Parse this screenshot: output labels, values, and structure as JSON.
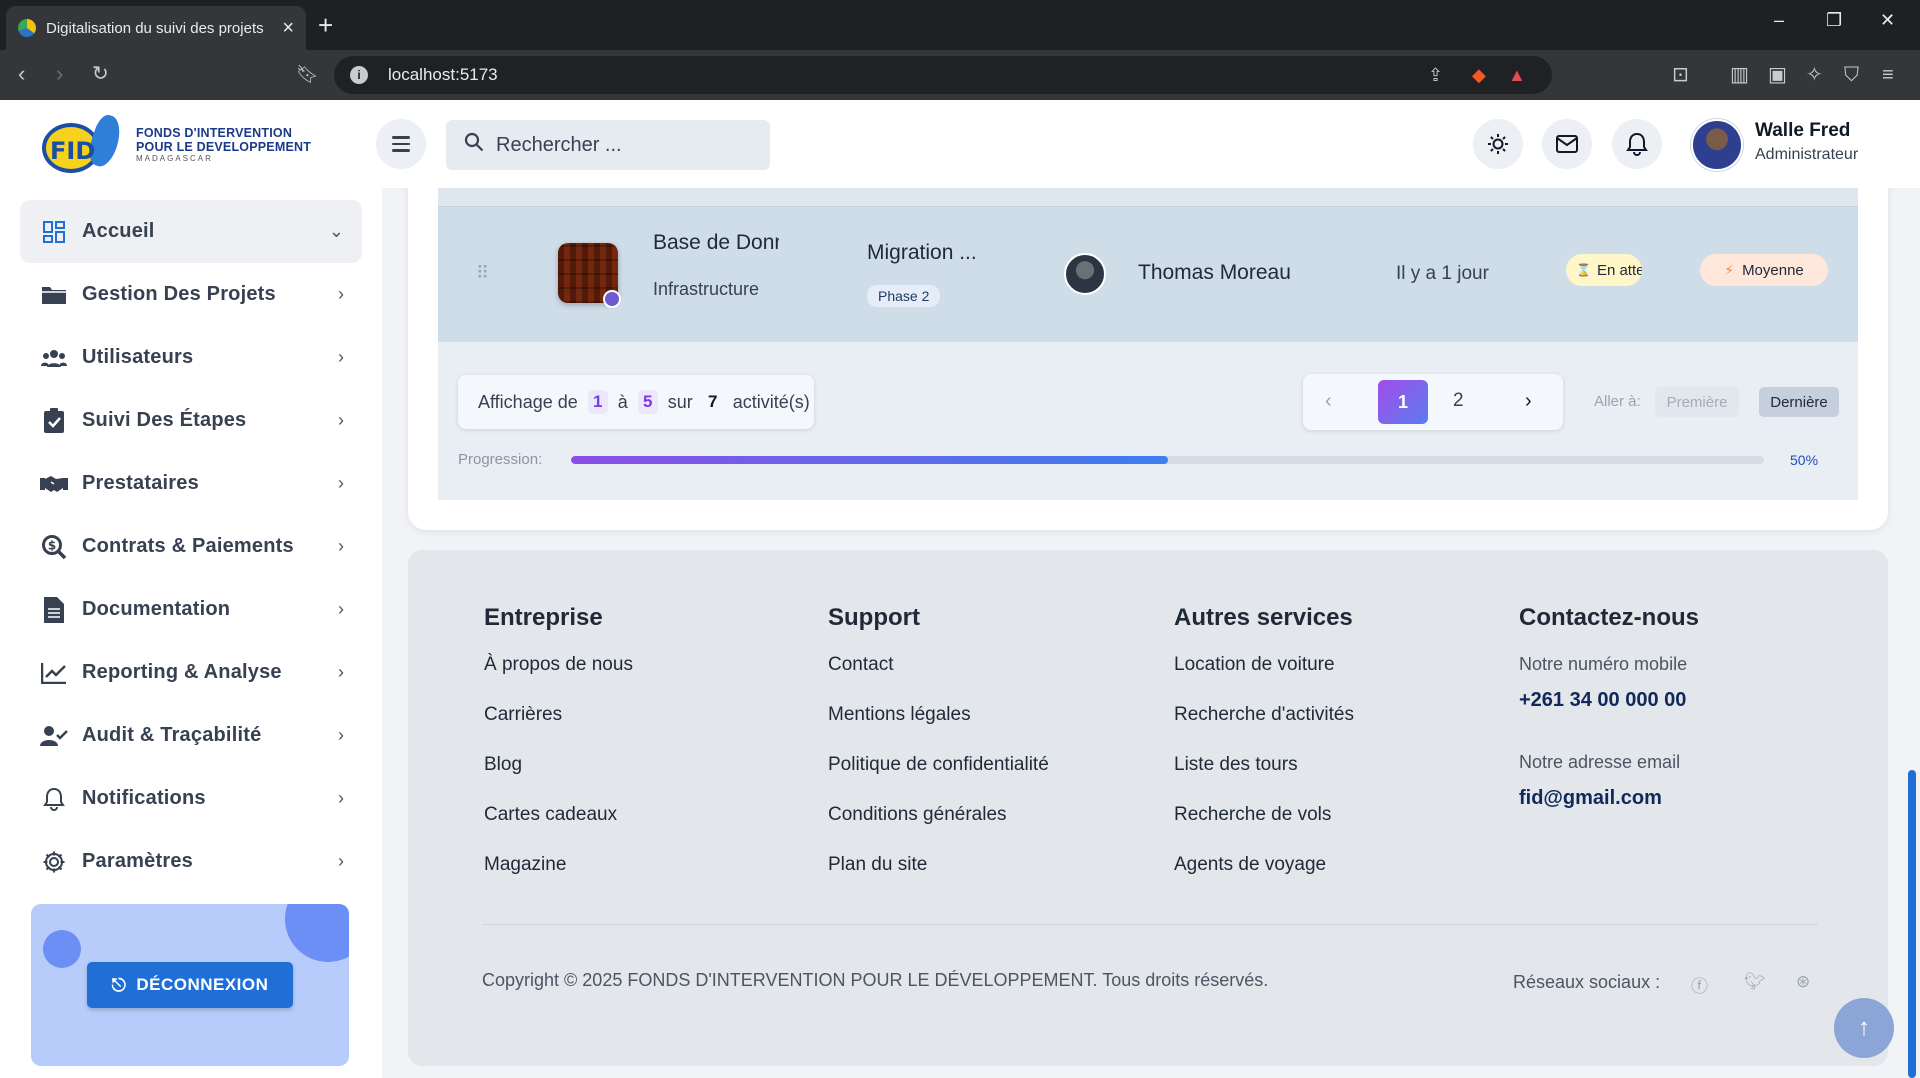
{
  "browser": {
    "tab_title": "Digitalisation du suivi des projets",
    "url": "localhost:5173"
  },
  "brand": {
    "line1": "FONDS D'INTERVENTION",
    "line2": "POUR LE DEVELOPPEMENT",
    "line3": "MADAGASCAR",
    "mark": "FID"
  },
  "search": {
    "placeholder": "Rechercher ..."
  },
  "user": {
    "name": "Walle Fred",
    "role": "Administrateur"
  },
  "sidebar": {
    "items": [
      {
        "label": "Accueil",
        "icon": "dashboard-icon",
        "active": true
      },
      {
        "label": "Gestion Des Projets",
        "icon": "folder-icon"
      },
      {
        "label": "Utilisateurs",
        "icon": "users-icon"
      },
      {
        "label": "Suivi Des Étapes",
        "icon": "clipboard-check-icon"
      },
      {
        "label": "Prestataires",
        "icon": "handshake-icon"
      },
      {
        "label": "Contrats & Paiements",
        "icon": "search-dollar-icon"
      },
      {
        "label": "Documentation",
        "icon": "document-icon"
      },
      {
        "label": "Reporting & Analyse",
        "icon": "chart-line-icon"
      },
      {
        "label": "Audit & Traçabilité",
        "icon": "user-check-icon"
      },
      {
        "label": "Notifications",
        "icon": "bell-icon"
      },
      {
        "label": "Paramètres",
        "icon": "gear-icon"
      }
    ],
    "logout_label": "DÉCONNEXION"
  },
  "activity": {
    "title": "Base de Données",
    "category": "Infrastructure",
    "project": "Migration ...",
    "phase": "Phase 2",
    "responsible": "Thomas Moreau",
    "time": "Il y a 1 jour",
    "status": "En attente",
    "priority": "Moyenne"
  },
  "pagination": {
    "prefix": "Affichage de",
    "from": "1",
    "sep1": "à",
    "to": "5",
    "sep2": "sur",
    "total": "7",
    "suffix": "activité(s)",
    "pages": [
      "1",
      "2"
    ],
    "current_page": "1",
    "goto_label": "Aller à:",
    "first_label": "Première",
    "last_label": "Dernière"
  },
  "progress": {
    "label": "Progression:",
    "value_text": "50%",
    "value": 0.5
  },
  "footer": {
    "col1": {
      "title": "Entreprise",
      "links": [
        "À propos de nous",
        "Carrières",
        "Blog",
        "Cartes cadeaux",
        "Magazine"
      ]
    },
    "col2": {
      "title": "Support",
      "links": [
        "Contact",
        "Mentions légales",
        "Politique de confidentialité",
        "Conditions générales",
        "Plan du site"
      ]
    },
    "col3": {
      "title": "Autres services",
      "links": [
        "Location de voiture",
        "Recherche d'activités",
        "Liste des tours",
        "Recherche de vols",
        "Agents de voyage"
      ]
    },
    "col4": {
      "title": "Contactez-nous",
      "phone_label": "Notre numéro mobile",
      "phone": "+261 34 00 000 00",
      "email_label": "Notre adresse email",
      "email": "fid@gmail.com"
    },
    "copyright": "Copyright © 2025 FONDS D'INTERVENTION POUR LE DÉVELOPPEMENT. Tous droits réservés.",
    "social_label": "Réseaux sociaux :",
    "social_icons": [
      "facebook-icon",
      "twitter-icon",
      "dribbble-icon"
    ]
  },
  "colors": {
    "accent": "#1f6fd6",
    "pagination_active_start": "#a24de8",
    "pagination_active_end": "#5a7cf0",
    "status_bg": "#fff6c9",
    "priority_bg": "#ffe7dc"
  }
}
